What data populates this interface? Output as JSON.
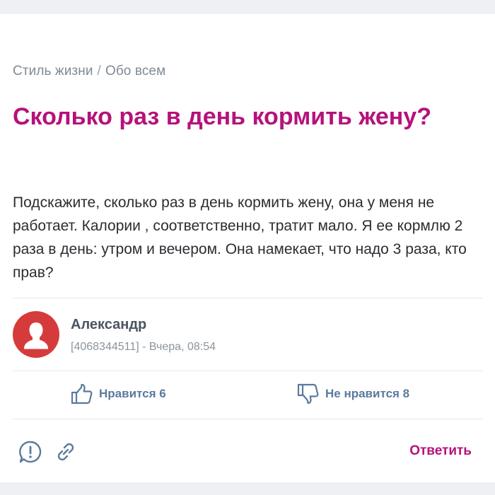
{
  "breadcrumb": {
    "category": "Стиль жизни",
    "separator": "/",
    "subcategory": "Обо всем"
  },
  "question": {
    "title": "Сколько раз в день кормить жену?",
    "text": "Подскажите, сколько раз в день кормить жену, она у меня не работает. Калории , соответственно, тратит мало. Я ее кормлю 2 раза в день: утром и вечером. Она намекает, что надо 3 раза, кто прав?"
  },
  "author": {
    "name": "Александр",
    "meta": "[4068344511] - Вчера, 08:54"
  },
  "votes": {
    "like_label": "Нравится 6",
    "dislike_label": "Не нравится 8"
  },
  "actions": {
    "reply_label": "Ответить"
  },
  "icons": {
    "like": "thumbs-up-icon",
    "dislike": "thumbs-down-icon",
    "report": "alert-circle-icon",
    "link": "chain-link-icon",
    "avatar": "user-silhouette-icon"
  },
  "colors": {
    "accent": "#b5127b",
    "vote": "#5b7a9c",
    "avatar_bg": "#d63b3b",
    "muted": "#7e8a96"
  }
}
